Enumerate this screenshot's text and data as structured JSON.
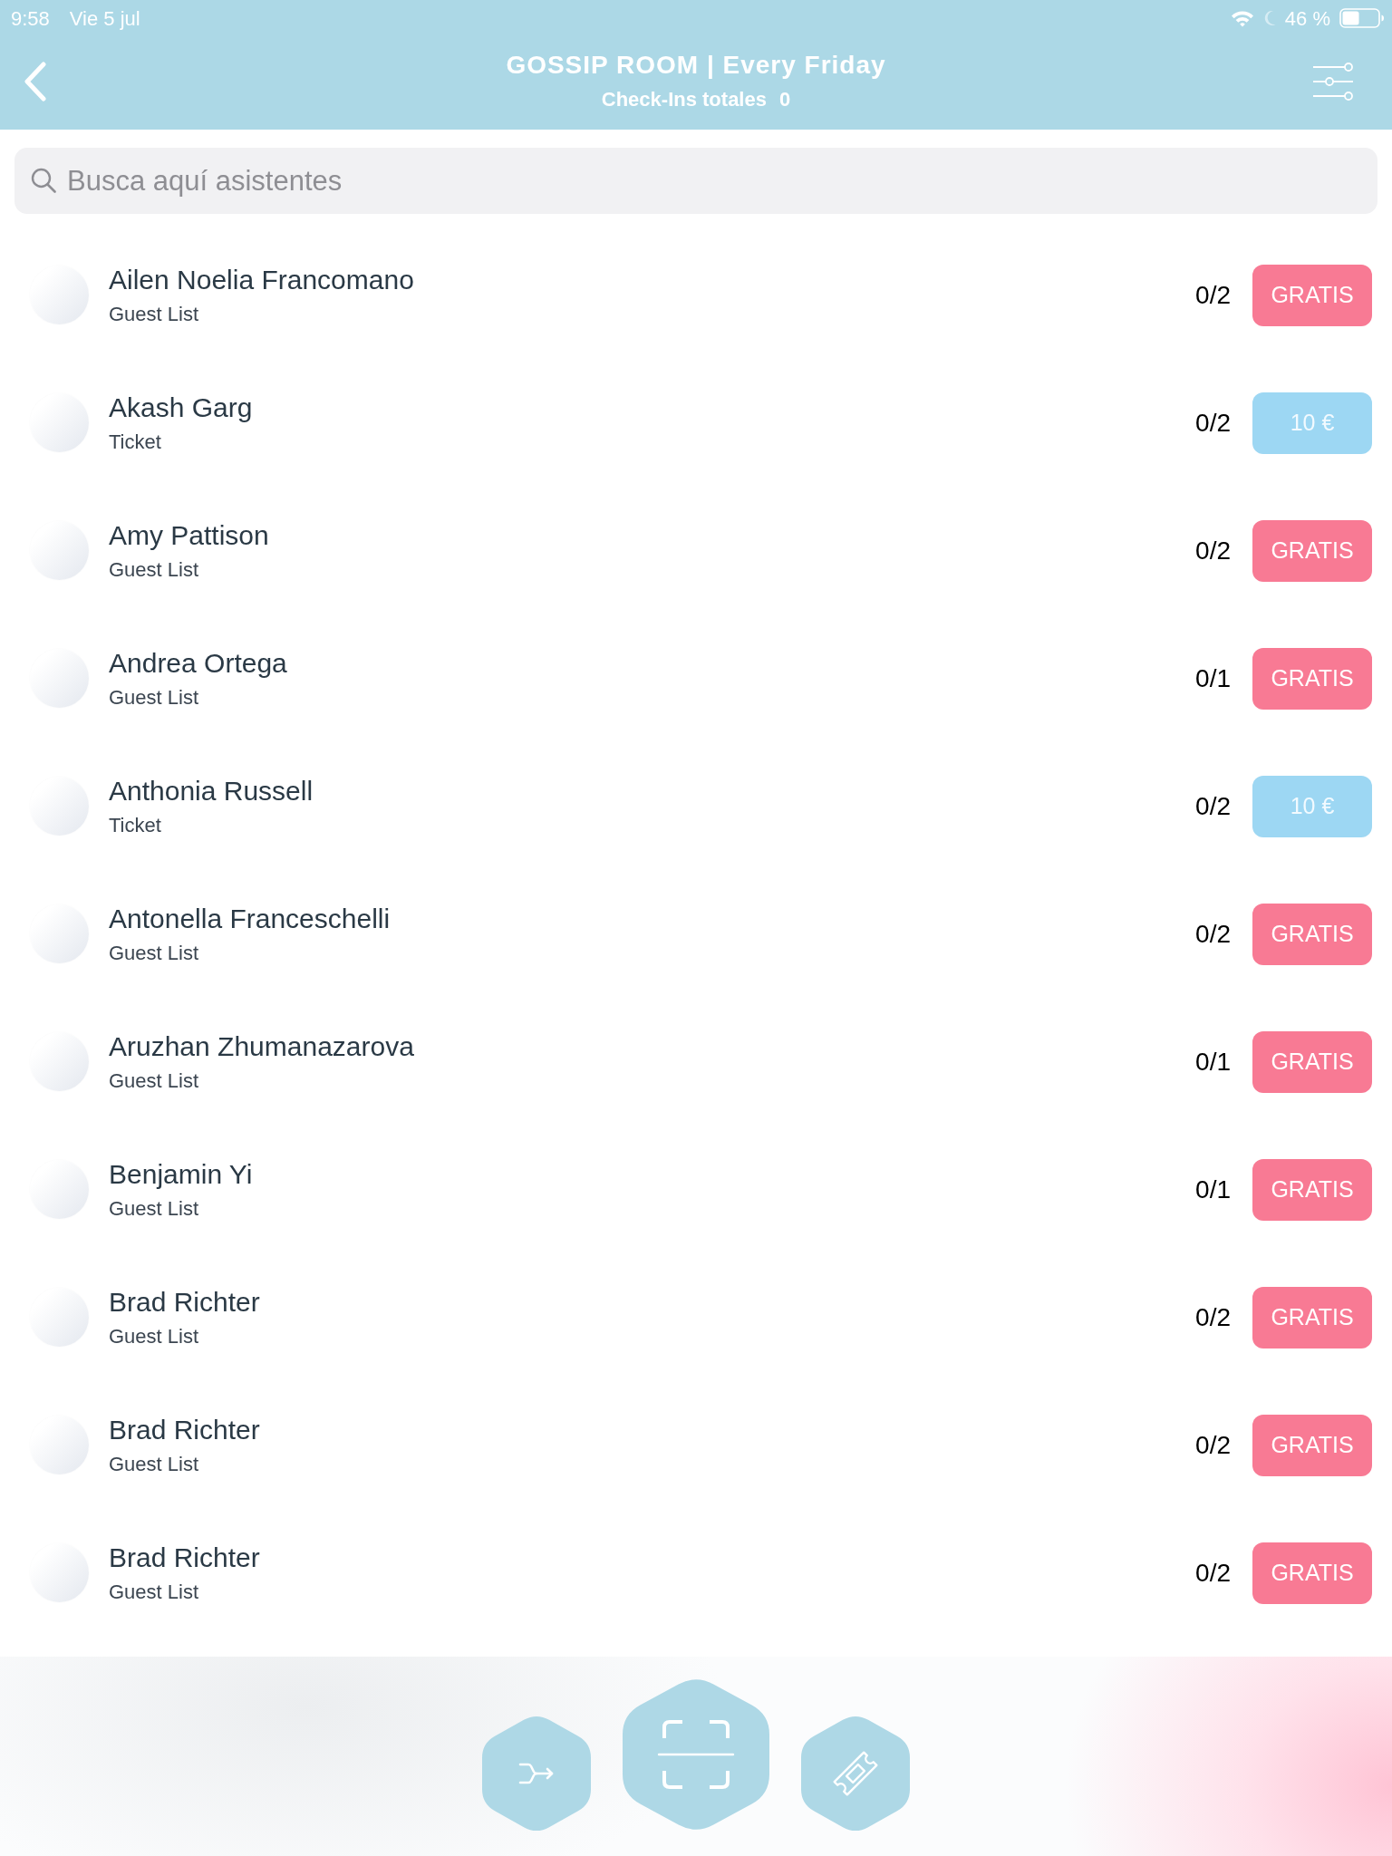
{
  "status_bar": {
    "time": "9:58",
    "date": "Vie 5 jul",
    "battery": "46 %"
  },
  "header": {
    "title": "GOSSIP ROOM | Every Friday",
    "checkins_label": "Check-Ins totales",
    "checkins_count": "0"
  },
  "search": {
    "placeholder": "Busca aquí asistentes"
  },
  "attendees": [
    {
      "name": "Ailen Noelia Francomano",
      "list": "Guest List",
      "count": "0/2",
      "price": "GRATIS",
      "kind": "free"
    },
    {
      "name": "Akash Garg",
      "list": "Ticket",
      "count": "0/2",
      "price": "10 €",
      "kind": "paid"
    },
    {
      "name": "Amy Pattison",
      "list": "Guest List",
      "count": "0/2",
      "price": "GRATIS",
      "kind": "free"
    },
    {
      "name": "Andrea Ortega",
      "list": "Guest List",
      "count": "0/1",
      "price": "GRATIS",
      "kind": "free"
    },
    {
      "name": "Anthonia Russell",
      "list": "Ticket",
      "count": "0/2",
      "price": "10 €",
      "kind": "paid"
    },
    {
      "name": "Antonella Franceschelli",
      "list": "Guest List",
      "count": "0/2",
      "price": "GRATIS",
      "kind": "free"
    },
    {
      "name": "Aruzhan Zhumanazarova",
      "list": "Guest List",
      "count": "0/1",
      "price": "GRATIS",
      "kind": "free"
    },
    {
      "name": "Benjamin Yi",
      "list": "Guest List",
      "count": "0/1",
      "price": "GRATIS",
      "kind": "free"
    },
    {
      "name": "Brad Richter",
      "list": "Guest List",
      "count": "0/2",
      "price": "GRATIS",
      "kind": "free"
    },
    {
      "name": "Brad Richter",
      "list": "Guest List",
      "count": "0/2",
      "price": "GRATIS",
      "kind": "free"
    },
    {
      "name": "Brad Richter",
      "list": "Guest List",
      "count": "0/2",
      "price": "GRATIS",
      "kind": "free"
    }
  ]
}
